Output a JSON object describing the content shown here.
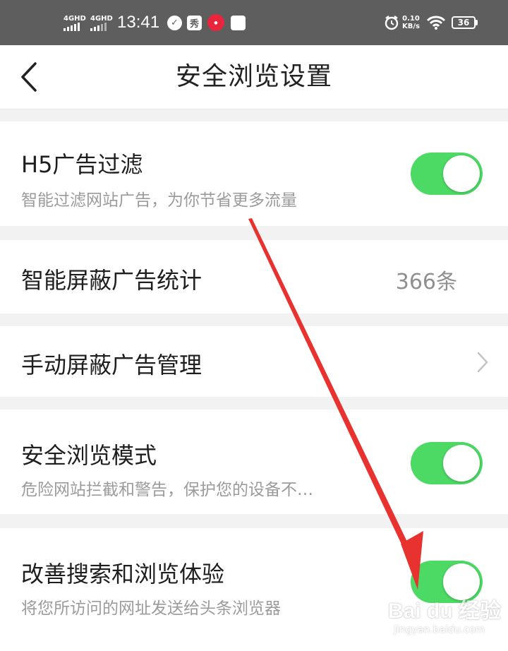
{
  "status_bar": {
    "sim1": "4GHD",
    "sim2": "4GHD",
    "time": "13:41",
    "app_icon_2": "秀",
    "net_speed_value": "0.10",
    "net_speed_unit": "KB/s",
    "battery": "36",
    "icons": [
      "signal-icon",
      "clock-app-icon",
      "red-app-icon",
      "notification-icon",
      "alarm-icon",
      "wifi-icon",
      "battery-icon"
    ]
  },
  "header": {
    "title": "安全浏览设置",
    "back_icon": "back-chevron-icon"
  },
  "settings": {
    "h5_filter": {
      "title": "H5广告过滤",
      "subtitle": "智能过滤网站广告，为你节省更多流量",
      "enabled": true
    },
    "block_stats": {
      "title": "智能屏蔽广告统计",
      "value": "366条"
    },
    "manual_block": {
      "title": "手动屏蔽广告管理",
      "icon": "chevron-right-icon"
    },
    "safe_mode": {
      "title": "安全浏览模式",
      "subtitle": "危险网站拦截和警告，保护您的设备不…",
      "enabled": true
    },
    "improve": {
      "title": "改善搜索和浏览体验",
      "subtitle": "将您所访问的网址发送给头条浏览器",
      "enabled": true
    }
  },
  "colors": {
    "toggle_on": "#4cd964",
    "status_bar_bg": "#5e5e5e",
    "arrow": "#e8322f"
  },
  "watermark": {
    "brand": "Bai du 经验",
    "url": "jingyan.baidu.com"
  }
}
